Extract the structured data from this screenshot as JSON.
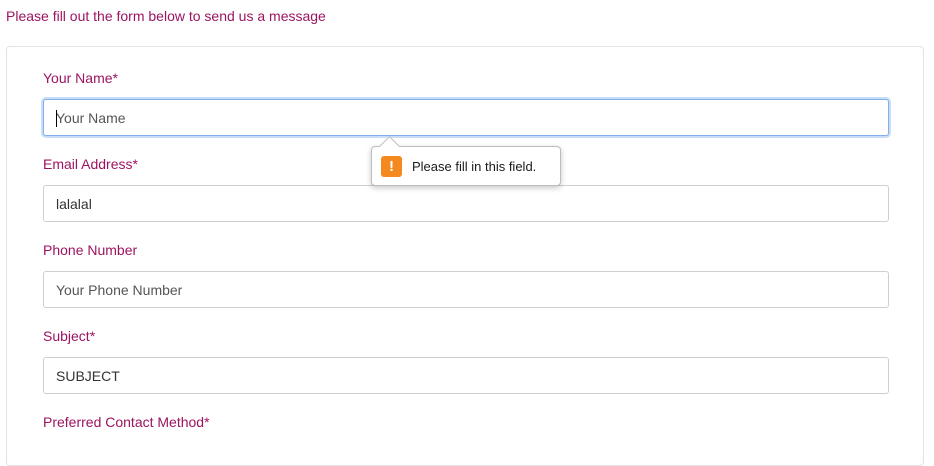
{
  "intro_text": "Please fill out the form below to send us a message",
  "form": {
    "name_label": "Your Name*",
    "name_placeholder": "Your Name",
    "name_value": "",
    "email_label": "Email Address*",
    "email_value": "lalalal",
    "phone_label": "Phone Number",
    "phone_placeholder": "Your Phone Number",
    "phone_value": "",
    "subject_label": "Subject*",
    "subject_value": "SUBJECT",
    "contact_method_label": "Preferred Contact Method*"
  },
  "validation_tooltip": {
    "icon": "warning-icon",
    "icon_glyph": "!",
    "message": "Please fill in this field."
  },
  "colors": {
    "label": "#9c1460",
    "focus_ring": "#7fb0e8",
    "warning": "#f48a1f"
  }
}
